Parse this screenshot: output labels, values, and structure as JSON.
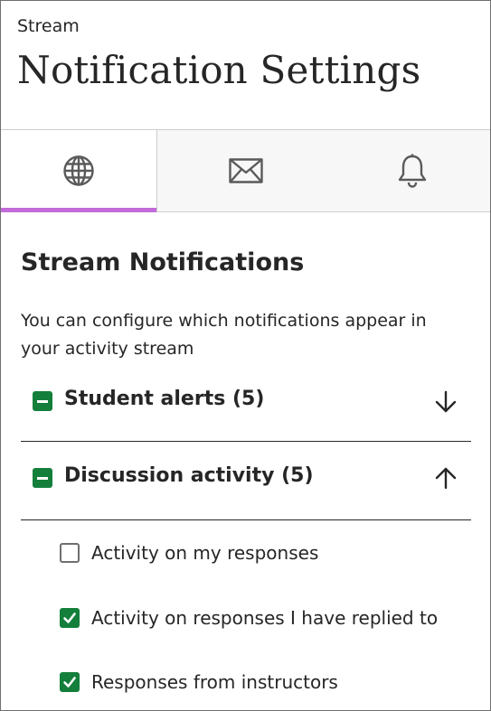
{
  "header": {
    "subtitle": "Stream",
    "title": "Notification Settings"
  },
  "tabs": [
    {
      "icon": "globe-icon",
      "selected": true
    },
    {
      "icon": "envelope-icon",
      "selected": false
    },
    {
      "icon": "bell-icon",
      "selected": false
    }
  ],
  "colors": {
    "accent_underline": "#c16cd9",
    "checkbox_green": "#137f3b",
    "text": "#262626"
  },
  "section": {
    "title": "Stream Notifications",
    "description": "You can configure which notifications appear in your activity stream"
  },
  "groups": [
    {
      "label": "Student alerts (5)",
      "expanded": false,
      "arrow_icon": "arrow-down-icon"
    },
    {
      "label": "Discussion activity (5)",
      "expanded": true,
      "arrow_icon": "arrow-up-icon"
    }
  ],
  "options": [
    {
      "label": "Activity on my responses",
      "checked": false
    },
    {
      "label": "Activity on responses I have replied to",
      "checked": true
    },
    {
      "label": "Responses from instructors",
      "checked": true
    }
  ]
}
